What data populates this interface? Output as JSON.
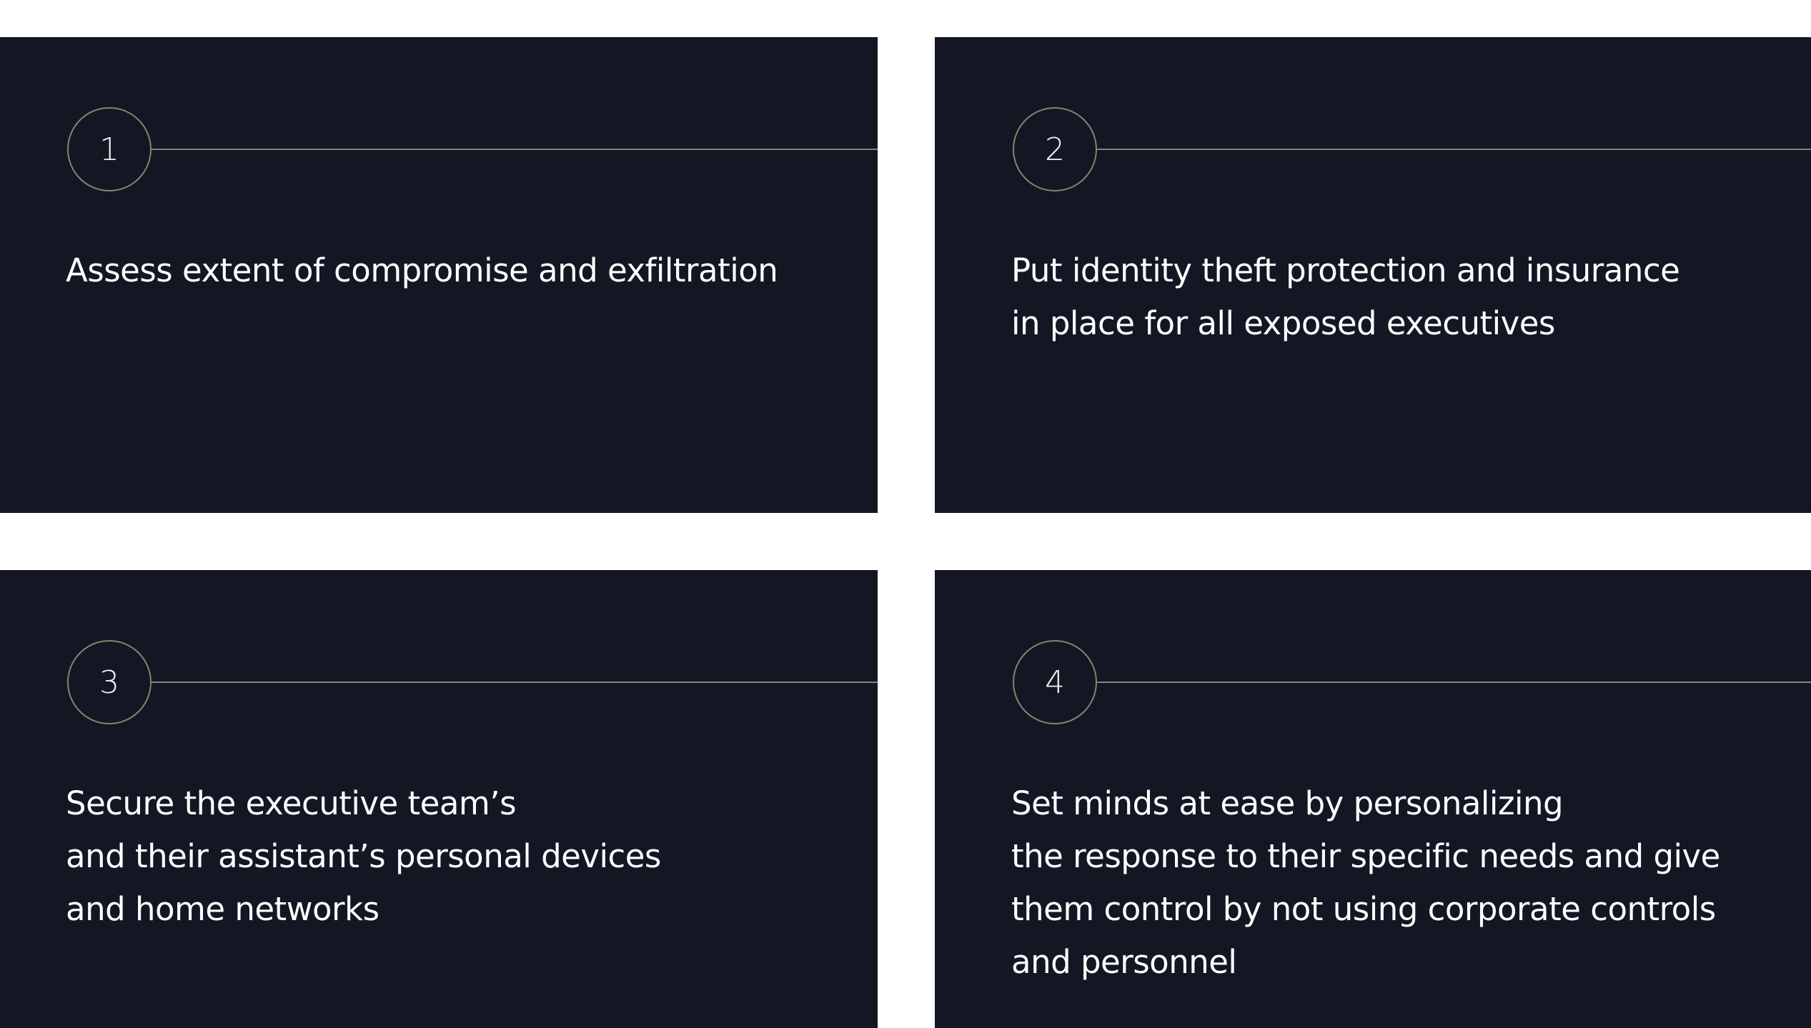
{
  "colors": {
    "card_background": "#131724",
    "accent_line": "#8c806d",
    "text": "#ffffff",
    "page_background": "#ffffff"
  },
  "steps": [
    {
      "number": "1",
      "lines": [
        "Assess extent of compromise and exfiltration"
      ]
    },
    {
      "number": "2",
      "lines": [
        "Put identity theft protection and insurance",
        "in place for all exposed executives"
      ]
    },
    {
      "number": "3",
      "lines": [
        "Secure the executive team’s",
        "and their assistant’s personal devices",
        "and home networks"
      ]
    },
    {
      "number": "4",
      "lines": [
        "Set minds at ease by personalizing",
        "the response to their specific needs and give",
        "them control by not using corporate controls",
        "and personnel"
      ]
    }
  ]
}
